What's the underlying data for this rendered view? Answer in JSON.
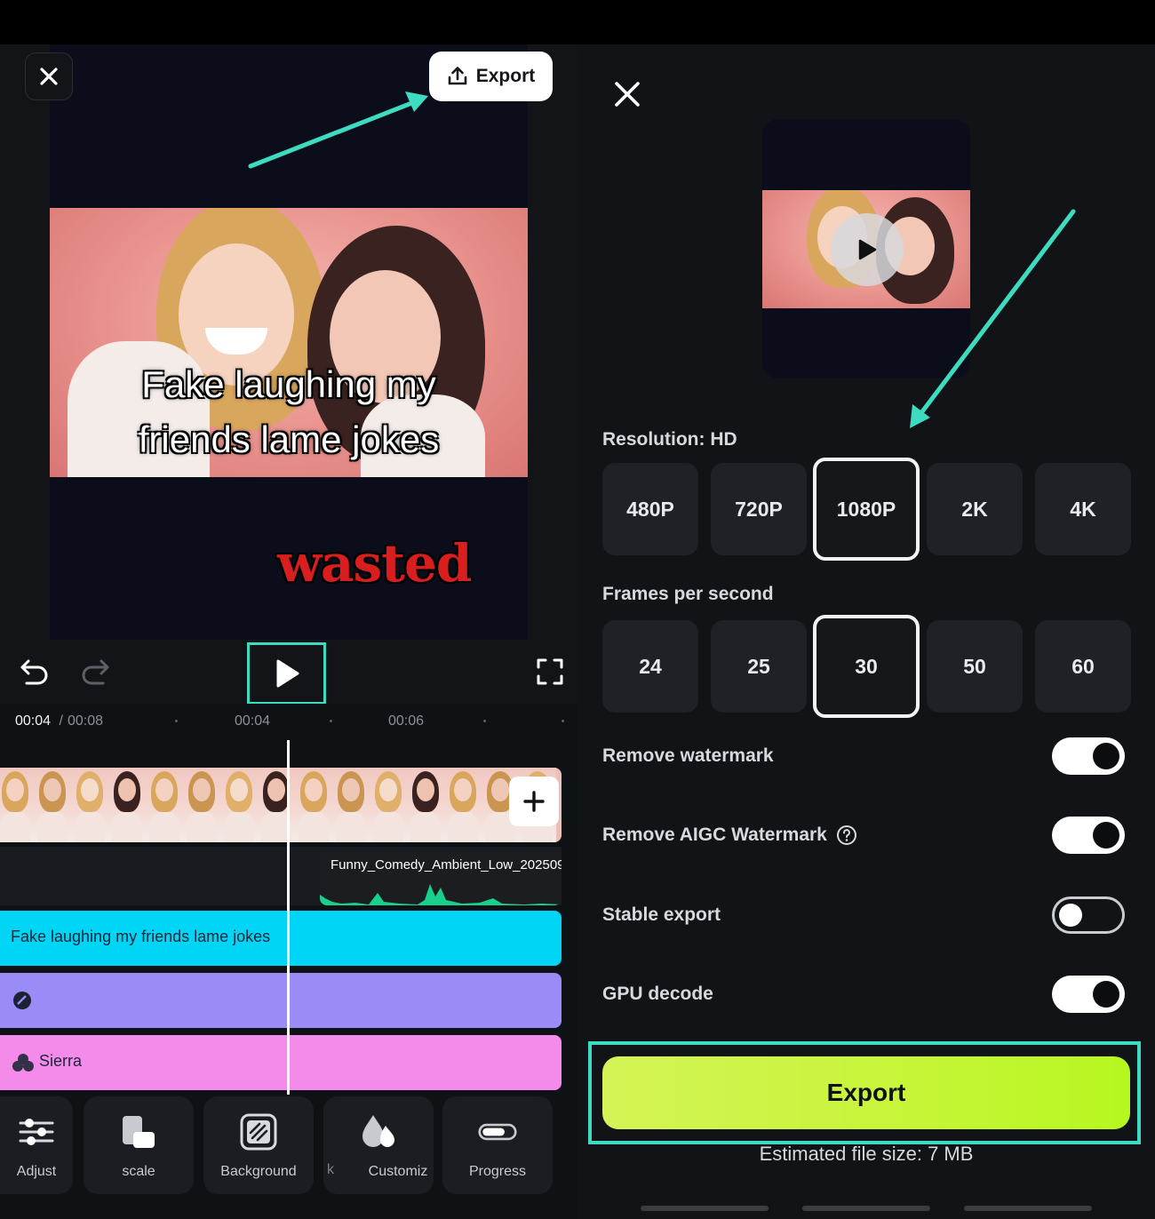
{
  "editor": {
    "export_label": "Export",
    "caption_line1": "Fake laughing my",
    "caption_line2": "friends lame jokes",
    "sticker_text": "wasted",
    "time_current": "00:04",
    "time_separator": " / ",
    "time_total": "00:08",
    "ruler_marks": [
      "00:04",
      "00:06"
    ],
    "audio_clip_name": "Funny_Comedy_Ambient_Low_202509",
    "text_track_label": "Fake laughing my  friends lame jokes",
    "filter_track_label": "Sierra",
    "tools": [
      {
        "label": "Adjust",
        "icon": "adjust-icon"
      },
      {
        "label": "scale",
        "icon": "scale-icon"
      },
      {
        "label": "Background",
        "icon": "background-icon"
      },
      {
        "label": "k",
        "icon": ""
      },
      {
        "label": "Customiz",
        "icon": "customize-icon"
      },
      {
        "label": "Progress",
        "icon": "progress-icon"
      }
    ]
  },
  "export_panel": {
    "resolution_title": "Resolution: HD",
    "resolutions": [
      "480P",
      "720P",
      "1080P",
      "2K",
      "4K"
    ],
    "selected_resolution": "1080P",
    "fps_title": "Frames per second",
    "fps_options": [
      "24",
      "25",
      "30",
      "50",
      "60"
    ],
    "selected_fps": "30",
    "toggles": [
      {
        "label": "Remove watermark",
        "on": true
      },
      {
        "label": "Remove AIGC Watermark",
        "on": true,
        "help_icon": "question-circle-icon"
      },
      {
        "label": "Stable export",
        "on": false
      },
      {
        "label": "GPU decode",
        "on": true
      }
    ],
    "export_button": "Export",
    "estimated_size": "Estimated file size: 7 MB"
  },
  "colors": {
    "accent_highlight": "#3ddbc0",
    "export_button": "#c6f537",
    "text_track": "#00d5f5",
    "effect_track": "#9a8cf6",
    "filter_track": "#f48ae9"
  }
}
